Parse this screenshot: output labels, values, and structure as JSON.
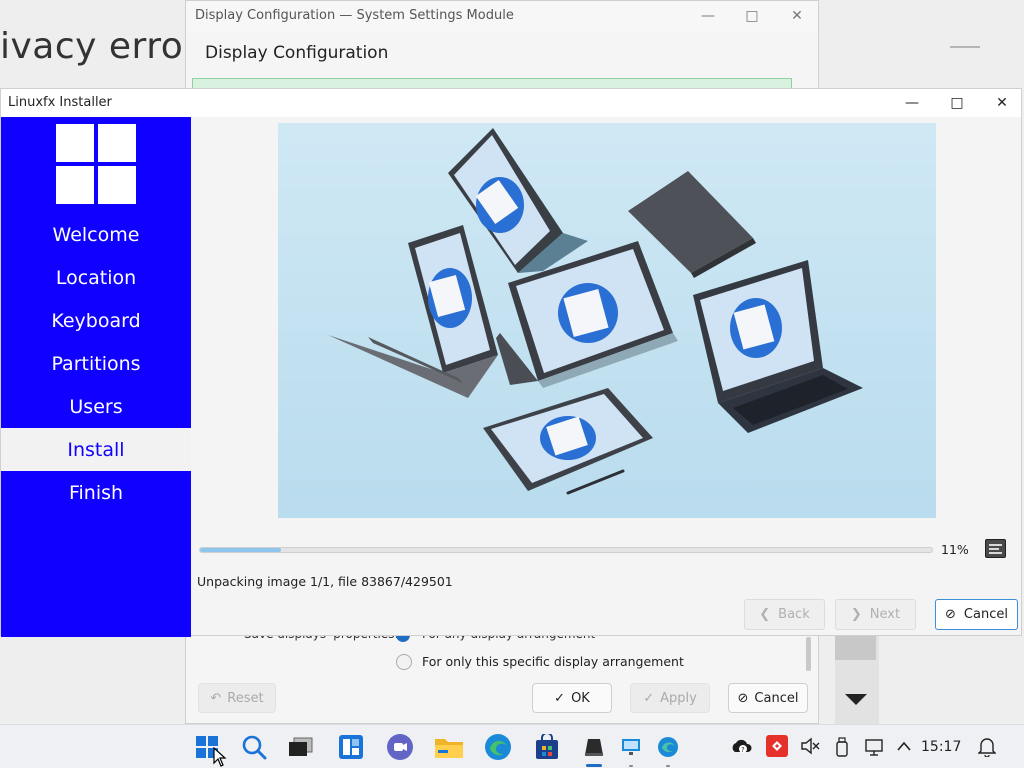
{
  "background": {
    "error_text": "ivacy error"
  },
  "display_config": {
    "window_title": "Display Configuration — System Settings Module",
    "header": "Display Configuration",
    "save_row_label": "Save displays' properties:",
    "radio_any_label": "For any display arrangement",
    "radio_specific_label": "For only this specific display arrangement",
    "reset_label": "Reset",
    "ok_label": "OK",
    "apply_label": "Apply",
    "cancel_label": "Cancel"
  },
  "installer": {
    "window_title": "Linuxfx Installer",
    "steps": [
      {
        "label": "Welcome"
      },
      {
        "label": "Location"
      },
      {
        "label": "Keyboard"
      },
      {
        "label": "Partitions"
      },
      {
        "label": "Users"
      },
      {
        "label": "Install"
      },
      {
        "label": "Finish"
      }
    ],
    "active_step": "Install",
    "progress_fraction": 0.11,
    "progress_text": "11%",
    "status_text": "Unpacking image 1/1, file 83867/429501",
    "back_label": "Back",
    "next_label": "Next",
    "cancel_label": "Cancel",
    "sidebar_color": "#1000ff"
  },
  "taskbar": {
    "clock": "15:17",
    "icons": [
      "start-icon",
      "search-icon",
      "task-view-icon",
      "widgets-icon",
      "teams-chat-icon",
      "file-explorer-icon",
      "edge-icon",
      "store-icon",
      "installer-icon",
      "display-settings-icon",
      "edge-dev-icon"
    ],
    "tray_icons": [
      "onedrive-icon",
      "anydesk-icon",
      "volume-muted-icon",
      "usb-icon",
      "network-icon",
      "chevron-up-icon",
      "notification-bell-icon"
    ]
  }
}
